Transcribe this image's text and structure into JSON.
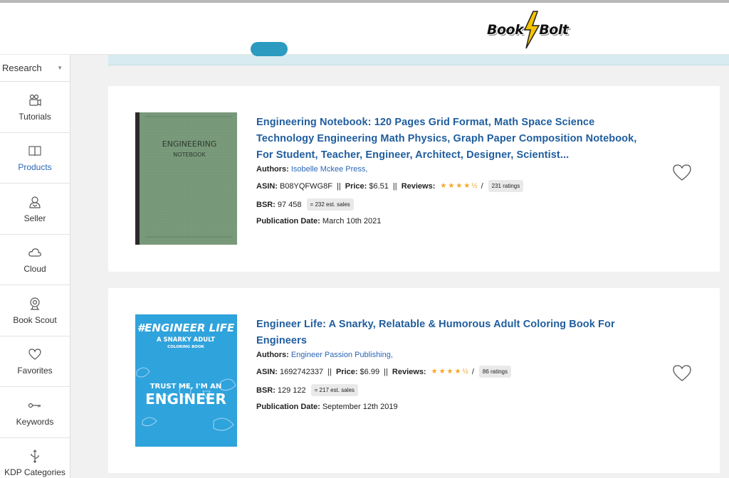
{
  "brand": {
    "logo_text_left": "Book",
    "logo_text_right": "Bolt"
  },
  "sidebar": {
    "dropdown_label": "Research",
    "items": [
      {
        "label": "Tutorials",
        "icon": "video-camera-icon"
      },
      {
        "label": "Products",
        "icon": "book-icon"
      },
      {
        "label": "Seller",
        "icon": "user-icon"
      },
      {
        "label": "Cloud",
        "icon": "cloud-icon"
      },
      {
        "label": "Book Scout",
        "icon": "webcam-icon"
      },
      {
        "label": "Favorites",
        "icon": "heart-icon"
      },
      {
        "label": "Keywords",
        "icon": "key-icon"
      },
      {
        "label": "KDP Categories",
        "icon": "usb-icon"
      }
    ],
    "active_index": 1
  },
  "products": [
    {
      "title": "Engineering Notebook: 120 Pages Grid Format, Math Space Science Technology Engineering Math Physics, Graph Paper Composition Notebook, For Student, Teacher, Engineer, Architect, Designer, Scientist...",
      "authors_label": "Authors:",
      "authors": "Isobelle Mckee Press,",
      "asin_label": "ASIN:",
      "asin": "B08YQFWG8F",
      "price_label": "Price:",
      "price": "$6.51",
      "reviews_label": "Reviews:",
      "rating": 4.5,
      "ratings_badge": "231 ratings",
      "bsr_label": "BSR:",
      "bsr": "97 458",
      "sales_badge": "= 232 est. sales",
      "pub_label": "Publication Date:",
      "pub_date": "March 10th 2021",
      "cover": {
        "line1": "ENGINEERING",
        "line2": "NOTEBOOK",
        "bg": "#7a9a7c",
        "spine": "#2a2a2a"
      }
    },
    {
      "title": "Engineer Life: A Snarky, Relatable & Humorous Adult Coloring Book For Engineers",
      "authors_label": "Authors:",
      "authors": "Engineer Passion Publishing,",
      "asin_label": "ASIN:",
      "asin": "1692742337",
      "price_label": "Price:",
      "price": "$6.99",
      "reviews_label": "Reviews:",
      "rating": 4.5,
      "ratings_badge": "86 ratings",
      "bsr_label": "BSR:",
      "bsr": "129 122",
      "sales_badge": "= 217 est. sales",
      "pub_label": "Publication Date:",
      "pub_date": "September 12th 2019",
      "cover": {
        "line1": "#ENGINEER LIFE",
        "line2": "A SNARKY ADULT",
        "line3": "COLORING BOOK",
        "line4": "TRUST ME, I'M AN",
        "line5": "ENGINEER",
        "bg": "#2fa3dc"
      }
    }
  ],
  "colors": {
    "link": "#1f5d9e",
    "star": "#f5a623",
    "banner": "#d7ebf0",
    "accent": "#2c9bbf"
  }
}
